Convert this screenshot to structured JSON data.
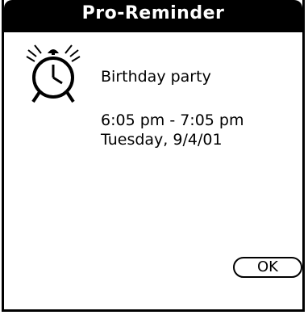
{
  "dialog": {
    "title": "Pro-Reminder",
    "icon": "alarm-clock-icon",
    "event_title": "Birthday party",
    "event_time": "6:05 pm - 7:05 pm",
    "event_date": "Tuesday, 9/4/01",
    "ok_label": "OK"
  },
  "colors": {
    "titlebar_bg": "#000000",
    "titlebar_text": "#ffffff",
    "background": "#ffffff",
    "text": "#000000"
  }
}
